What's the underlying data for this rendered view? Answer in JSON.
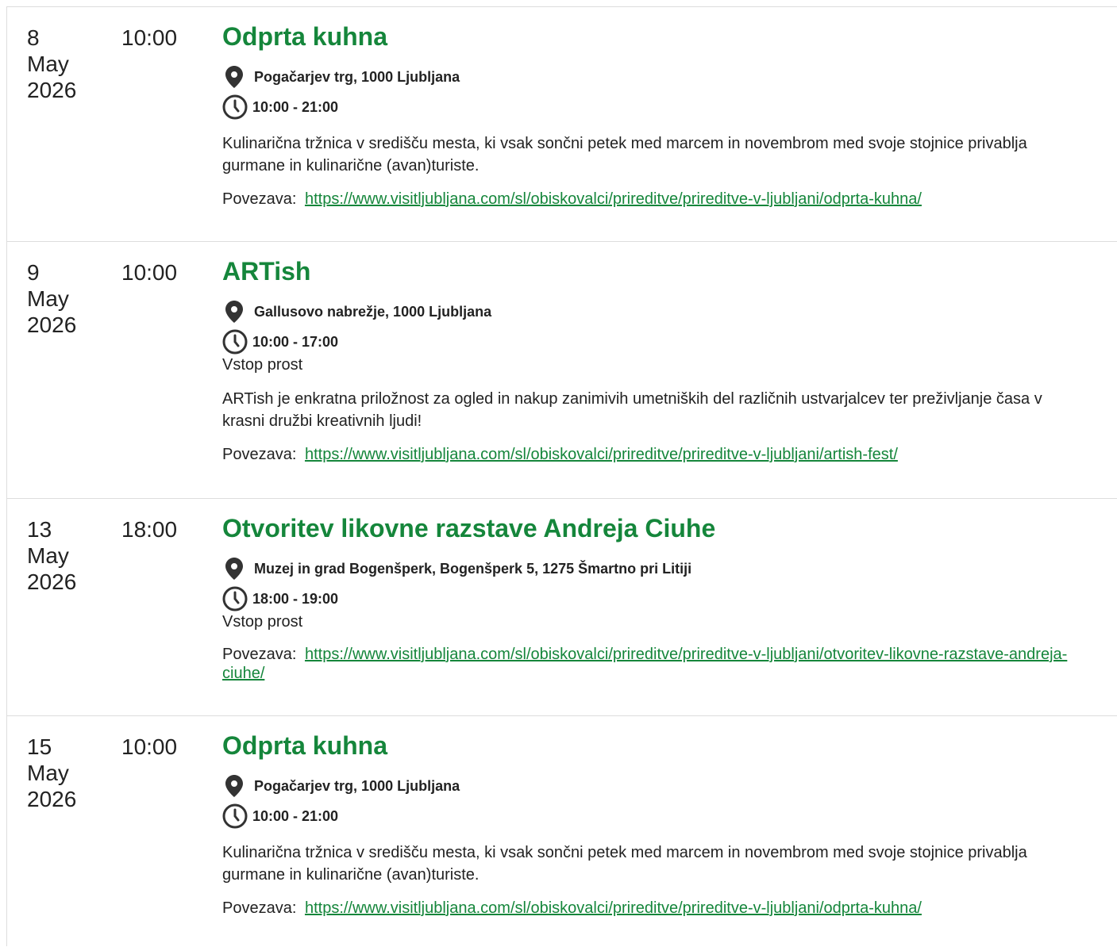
{
  "accent_color": "#15863b",
  "icons": {
    "location": "map-pin-icon",
    "time": "clock-icon"
  },
  "link_label": "Povezava:",
  "events": [
    {
      "day": "8",
      "month": "May",
      "year": "2026",
      "start": "10:00",
      "title": "Odprta kuhna",
      "location": "Pogačarjev trg, 1000 Ljubljana",
      "hours": "10:00 - 21:00",
      "entry": "",
      "description": "Kulinarična tržnica v središču mesta, ki vsak sončni petek med marcem in novembrom med svoje stojnice privablja gurmane in kulinarične (avan)turiste.",
      "url": "https://www.visitljubljana.com/sl/obiskovalci/prireditve/prireditve-v-ljubljani/odprta-kuhna/"
    },
    {
      "day": "9",
      "month": "May",
      "year": "2026",
      "start": "10:00",
      "title": "ARTish",
      "location": "Gallusovo nabrežje, 1000 Ljubljana",
      "hours": "10:00 - 17:00",
      "entry": "Vstop prost",
      "description": "ARTish je enkratna priložnost za ogled in nakup zanimivih umetniških del različnih ustvarjalcev ter preživljanje časa v krasni družbi kreativnih ljudi!",
      "url": "https://www.visitljubljana.com/sl/obiskovalci/prireditve/prireditve-v-ljubljani/artish-fest/"
    },
    {
      "day": "13",
      "month": "May",
      "year": "2026",
      "start": "18:00",
      "title": "Otvoritev likovne razstave Andreja Ciuhe",
      "location": "Muzej in grad Bogenšperk, Bogenšperk 5, 1275 Šmartno pri Litiji",
      "hours": "18:00 - 19:00",
      "entry": "Vstop prost",
      "description": "",
      "url": "https://www.visitljubljana.com/sl/obiskovalci/prireditve/prireditve-v-ljubljani/otvoritev-likovne-razstave-andreja-ciuhe/"
    },
    {
      "day": "15",
      "month": "May",
      "year": "2026",
      "start": "10:00",
      "title": "Odprta kuhna",
      "location": "Pogačarjev trg, 1000 Ljubljana",
      "hours": "10:00 - 21:00",
      "entry": "",
      "description": "Kulinarična tržnica v središču mesta, ki vsak sončni petek med marcem in novembrom med svoje stojnice privablja gurmane in kulinarične (avan)turiste.",
      "url": "https://www.visitljubljana.com/sl/obiskovalci/prireditve/prireditve-v-ljubljani/odprta-kuhna/"
    }
  ]
}
